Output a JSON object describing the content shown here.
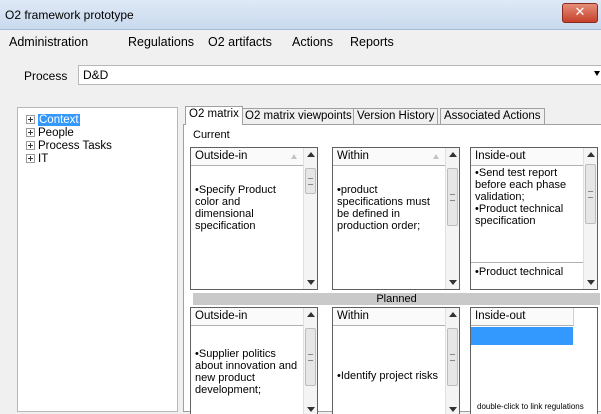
{
  "window": {
    "title": "O2 framework prototype",
    "close_glyph": "✕"
  },
  "menu": {
    "items": [
      "Administration",
      "Regulations",
      "O2 artifacts",
      "Actions",
      "Reports"
    ]
  },
  "process": {
    "label": "Process",
    "value": "D&D"
  },
  "tree": {
    "items": [
      {
        "label": "Context",
        "selected": true
      },
      {
        "label": "People",
        "selected": false
      },
      {
        "label": "Process Tasks",
        "selected": false
      },
      {
        "label": "IT",
        "selected": false
      }
    ]
  },
  "tabs": [
    {
      "label": "O2 matrix",
      "active": true
    },
    {
      "label": "O2 matrix viewpoints",
      "active": false
    },
    {
      "label": "Version History",
      "active": false
    },
    {
      "label": "Associated Actions",
      "active": false
    }
  ],
  "matrix": {
    "current_label": "Current",
    "planned_label": "Planned",
    "current": {
      "outside_in": {
        "header": "Outside-in",
        "lines": [
          "•Specify Product color and dimensional specification"
        ]
      },
      "within": {
        "header": "Within",
        "lines": [
          "•product specifications must be defined in production order;"
        ]
      },
      "inside_out": {
        "header": "Inside-out",
        "lines": [
          "•Send test report before each phase validation;",
          "•Product technical specification",
          "•Product technical"
        ]
      }
    },
    "planned": {
      "outside_in": {
        "header": "Outside-in",
        "lines": [
          "•Supplier politics about innovation and new product development;"
        ]
      },
      "within": {
        "header": "Within",
        "lines": [
          "•Identify project risks"
        ]
      },
      "inside_out": {
        "header": "Inside-out",
        "lines": []
      }
    },
    "hint": "double-click to link regulations"
  },
  "colors": {
    "selection": "#3399ff",
    "close_button": "#c6402a",
    "titlebar": "#dfe9f6"
  }
}
